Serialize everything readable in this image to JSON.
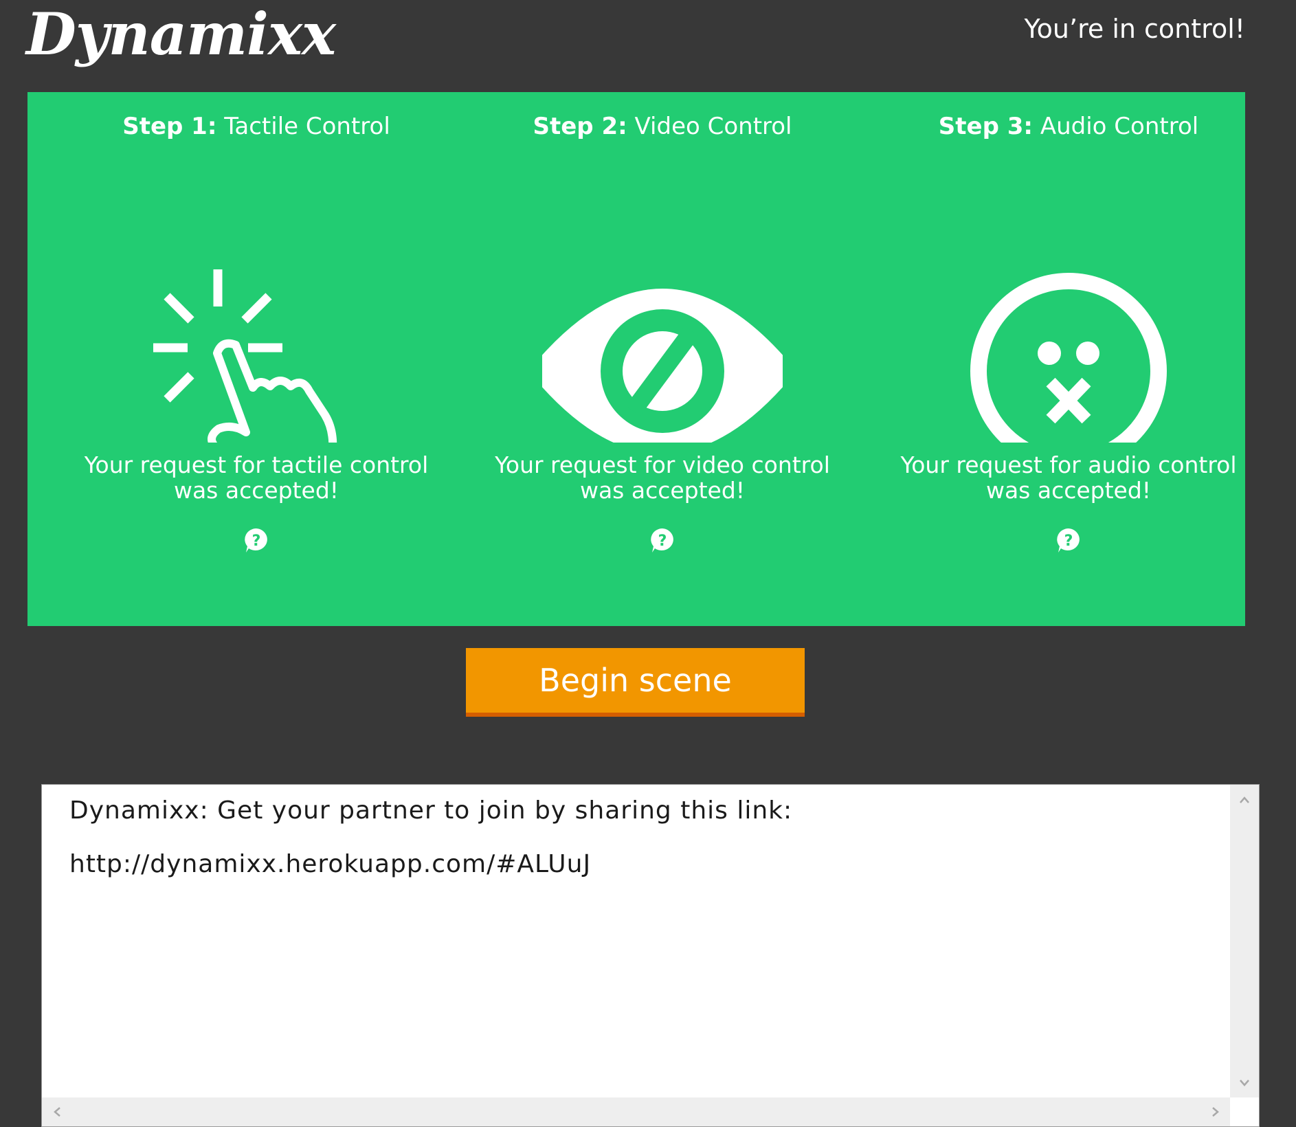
{
  "header": {
    "logo_text": "Dynamixx",
    "tagline": "You’re in control!"
  },
  "steps": [
    {
      "step_label": "Step 1:",
      "title": "Tactile Control",
      "icon": "tap-hand-icon",
      "message": "Your request for tactile control was accepted!",
      "help_icon": "help-bubble-icon"
    },
    {
      "step_label": "Step 2:",
      "title": "Video Control",
      "icon": "eye-blocked-icon",
      "message": "Your request for video control was accepted!",
      "help_icon": "help-bubble-icon"
    },
    {
      "step_label": "Step 3:",
      "title": "Audio Control",
      "icon": "muted-face-icon",
      "message": "Your request for audio control was accepted!",
      "help_icon": "help-bubble-icon"
    }
  ],
  "begin_button_label": "Begin scene",
  "chat": {
    "lines": [
      "Dynamixx: Get your partner to join by sharing this link:",
      "http://dynamixx.herokuapp.com/#ALUuJ"
    ]
  },
  "colors": {
    "background": "#383838",
    "panel_green": "#22cc72",
    "button_orange": "#f29600",
    "button_shadow": "#d45e00"
  }
}
